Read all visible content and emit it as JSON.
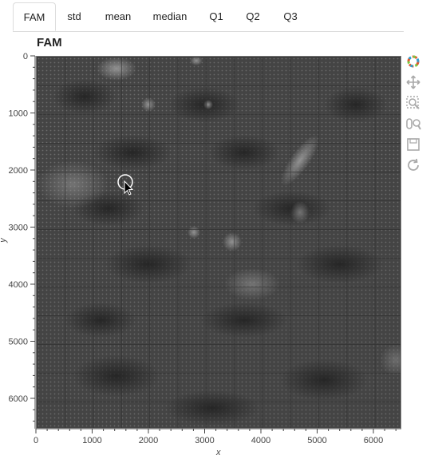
{
  "tabs": [
    {
      "label": "FAM",
      "active": true
    },
    {
      "label": "std"
    },
    {
      "label": "mean"
    },
    {
      "label": "median"
    },
    {
      "label": "Q1"
    },
    {
      "label": "Q2"
    },
    {
      "label": "Q3"
    }
  ],
  "plot": {
    "title": "FAM",
    "xlabel": "x",
    "ylabel": "y",
    "xrange": [
      0,
      6500
    ],
    "yrange": [
      0,
      6500
    ],
    "x_ticks": [
      "0",
      "1000",
      "2000",
      "3000",
      "4000",
      "5000",
      "6000"
    ],
    "y_ticks": [
      "0",
      "1000",
      "2000",
      "3000",
      "4000",
      "5000",
      "6000"
    ]
  },
  "toolbar": {
    "tools": [
      "bokeh-logo-icon",
      "pan-icon",
      "box-zoom-icon",
      "wheel-zoom-icon",
      "save-icon",
      "reset-icon"
    ]
  },
  "colors": {
    "image_background": "#3d3d3d",
    "tab_border": "#dcdcdc",
    "axis_text": "#444444"
  }
}
